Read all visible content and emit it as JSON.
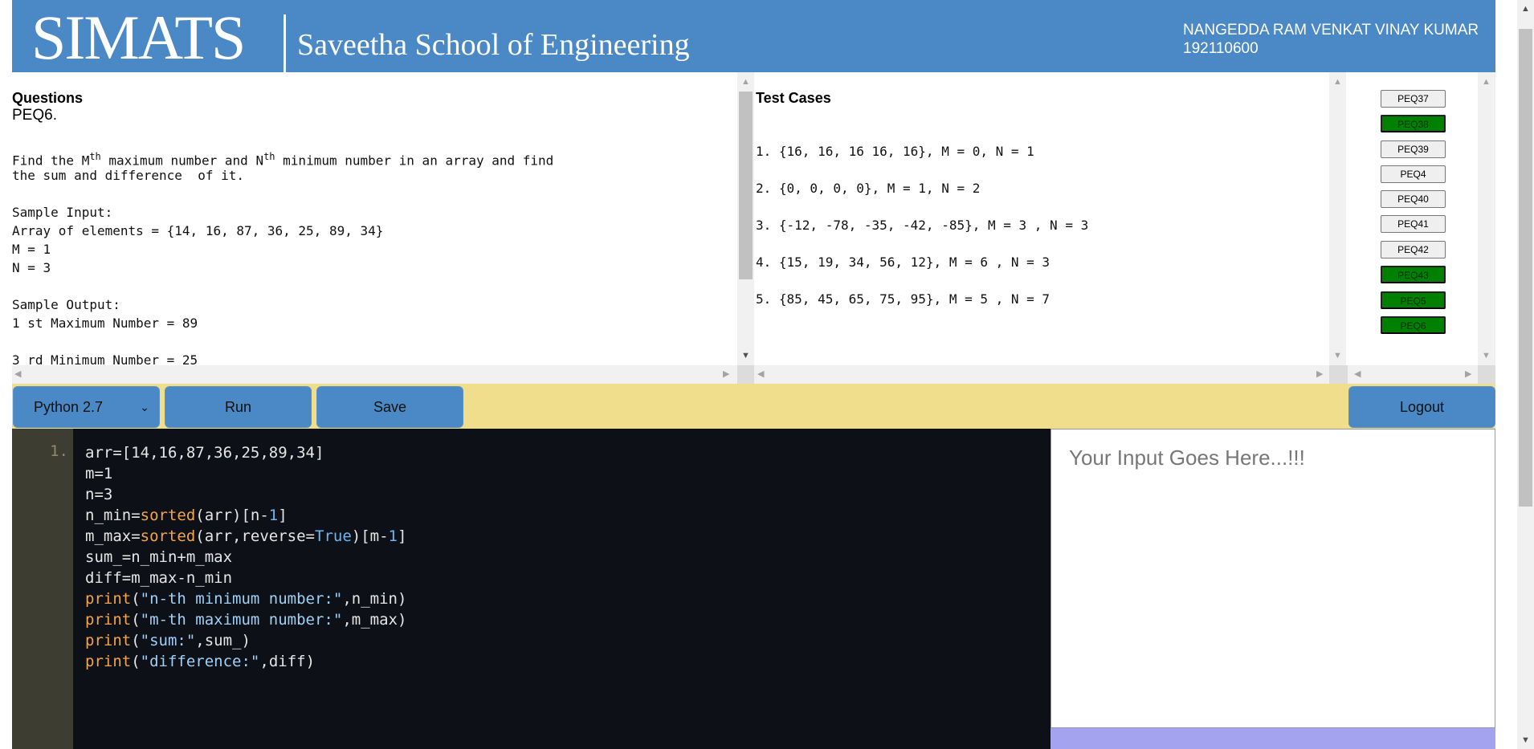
{
  "header": {
    "logo": "SIMATS",
    "school": "Saveetha School of Engineering",
    "user_name": "NANGEDDA RAM VENKAT VINAY KUMAR",
    "user_id": "192110600",
    "color": "#4a89c5"
  },
  "question": {
    "heading": "Questions",
    "id": "PEQ6.",
    "line1_a": "Find the M",
    "sup1": "th",
    "line1_b": " maximum number and N",
    "sup2": "th",
    "line1_c": " minimum number in an array and find",
    "line2": "the sum and difference  of it.",
    "body": "Sample Input:\nArray of elements = {14, 16, 87, 36, 25, 89, 34}\nM = 1\nN = 3\n\nSample Output:\n1 st Maximum Number = 89\n\n3 rd Minimum Number = 25"
  },
  "test_cases": {
    "heading": "Test Cases",
    "items": [
      "1. {16, 16, 16 16, 16}, M = 0, N = 1",
      "2. {0, 0, 0, 0}, M = 1, N = 2",
      "3. {-12, -78, -35, -42, -85}, M = 3 , N = 3",
      "4. {15, 19, 34, 56, 12}, M = 6 , N = 3",
      "5. {85, 45, 65, 75, 95}, M = 5 , N = 7"
    ]
  },
  "questions_list": [
    {
      "label": "PEQ37",
      "done": false
    },
    {
      "label": "PEQ38",
      "done": true
    },
    {
      "label": "PEQ39",
      "done": false
    },
    {
      "label": "PEQ4",
      "done": false
    },
    {
      "label": "PEQ40",
      "done": false
    },
    {
      "label": "PEQ41",
      "done": false
    },
    {
      "label": "PEQ42",
      "done": false
    },
    {
      "label": "PEQ43",
      "done": true
    },
    {
      "label": "PEQ5",
      "done": true
    },
    {
      "label": "PEQ6",
      "done": true
    }
  ],
  "toolbar": {
    "language": "Python 2.7",
    "run": "Run",
    "save": "Save",
    "logout": "Logout"
  },
  "editor": {
    "line_number": "1.",
    "lines": [
      "arr=[14,16,87,36,25,89,34]",
      "m=1",
      "n=3",
      "n_min=sorted(arr)[n-1]",
      "m_max=sorted(arr,reverse=True)[m-1]",
      "sum_=n_min+m_max",
      "diff=m_max-n_min",
      "print(\"n-th minimum number:\",n_min)",
      "print(\"m-th maximum number:\",m_max)",
      "print(\"sum:\",sum_)",
      "print(\"difference:\",diff)"
    ]
  },
  "input": {
    "placeholder": "Your Input Goes Here...!!!"
  }
}
